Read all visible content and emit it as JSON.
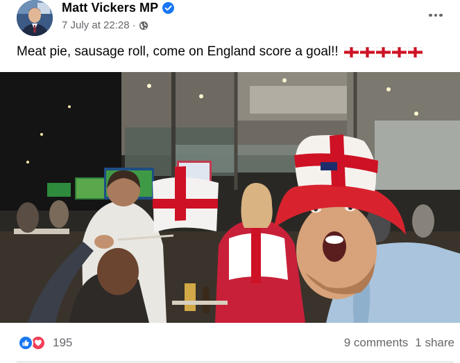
{
  "post": {
    "author": {
      "name": "Matt Vickers MP",
      "verified": true
    },
    "meta": {
      "date": "7 July at 22:28",
      "separator": "·",
      "audience_icon": "globe-icon"
    },
    "more_icon": "more-options-icon",
    "caption": "Meat pie, sausage roll, come on England score a goal!!",
    "caption_flags": [
      "england-flag",
      "england-flag",
      "england-flag",
      "england-flag",
      "england-flag"
    ],
    "photo_icon": "post-photo",
    "reactions": {
      "icons": [
        "like-icon",
        "love-icon"
      ],
      "count": "195"
    },
    "comments_label": "9 comments",
    "shares_label": "1 share"
  },
  "colors": {
    "brand_blue": "#1877f2",
    "love_red": "#f33e58",
    "secondary_text": "#65676b",
    "england_red": "#ce1124"
  }
}
